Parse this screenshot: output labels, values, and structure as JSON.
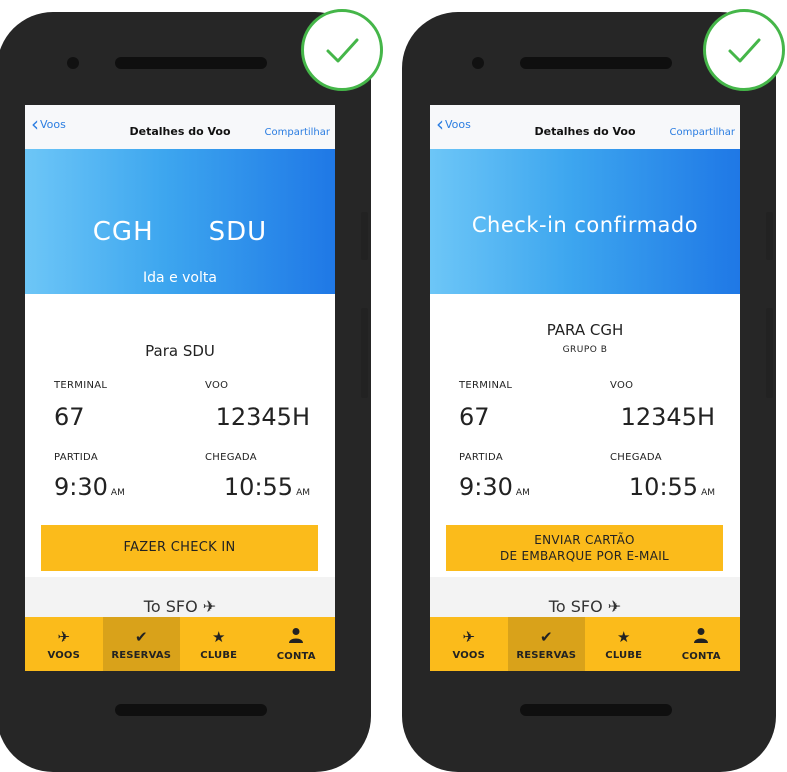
{
  "phones": [
    {
      "nav": {
        "back": "Voos",
        "title": "Detalhes do Voo",
        "share": "Compartilhar"
      },
      "hero": {
        "origin": "CGH",
        "destination": "SDU",
        "subtitle": "Ida e volta"
      },
      "destination": "Para SDU",
      "terminal_label": "TERMINAL",
      "terminal": "67",
      "flight_label": "VOO",
      "flight": "12345H",
      "departure_label": "PARTIDA",
      "departure": "9:30",
      "departure_ampm": "AM",
      "arrival_label": "CHEGADA",
      "arrival": "10:55",
      "arrival_ampm": "AM",
      "cta": "FAZER CHECK IN",
      "next": "To SFO"
    },
    {
      "nav": {
        "back": "Voos",
        "title": "Detalhes do Voo",
        "share": "Compartilhar"
      },
      "hero": {
        "title": "Check-in confirmado"
      },
      "destination": "PARA CGH",
      "group": "GRUPO B",
      "terminal_label": "TERMINAL",
      "terminal": "67",
      "flight_label": "VOO",
      "flight": "12345H",
      "departure_label": "PARTIDA",
      "departure": "9:30",
      "departure_ampm": "AM",
      "arrival_label": "CHEGADA",
      "arrival": "10:55",
      "arrival_ampm": "AM",
      "cta_line1": "ENVIAR CARTÃO",
      "cta_line2": "DE EMBARQUE POR E-MAIL",
      "next": "To SFO"
    }
  ],
  "tabbar": [
    {
      "label": "VOOS",
      "icon": "plane-icon"
    },
    {
      "label": "RESERVAS",
      "icon": "check-icon",
      "active": true
    },
    {
      "label": "CLUBE",
      "icon": "star-icon"
    },
    {
      "label": "CONTA",
      "icon": "person-icon"
    }
  ],
  "colors": {
    "accent": "#fbbb1b",
    "check": "#45b649",
    "link": "#2b7de1",
    "hero_start": "#6dc6f7",
    "hero_end": "#1f78e6"
  }
}
